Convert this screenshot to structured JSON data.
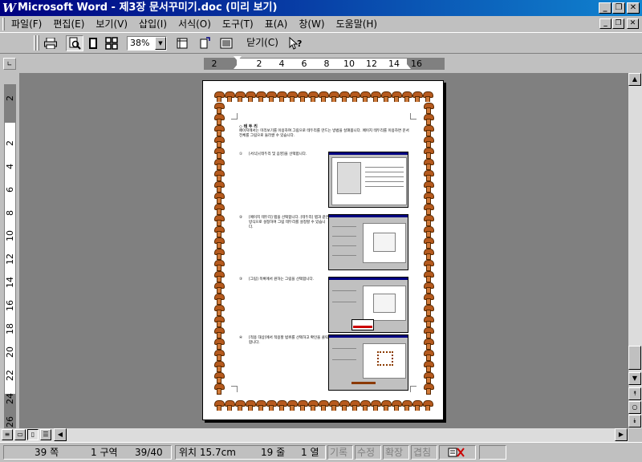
{
  "window": {
    "title": "Microsoft Word - 제3장 문서꾸미기.doc (미리 보기)",
    "app_icon": "W",
    "controls": {
      "minimize": "_",
      "restore": "❐",
      "close": "✕"
    }
  },
  "menu": {
    "items": [
      "파일(F)",
      "편집(E)",
      "보기(V)",
      "삽입(I)",
      "서식(O)",
      "도구(T)",
      "표(A)",
      "창(W)",
      "도움말(H)"
    ]
  },
  "toolbar": {
    "zoom_value": "38%",
    "close_label": "닫기(C)"
  },
  "ruler": {
    "horizontal_ticks": [
      "2",
      "2",
      "4",
      "6",
      "8",
      "10",
      "12",
      "14",
      "16"
    ],
    "vertical_ticks": [
      "2",
      "2",
      "4",
      "6",
      "8",
      "10",
      "12",
      "14",
      "16",
      "18",
      "20",
      "22",
      "24",
      "26"
    ]
  },
  "page": {
    "heading": "◇ 테 두 리",
    "intro": "페이지에서는 미리보기를 이용하여 그림으로 테두리를 만드는 방법을 살펴봅니다. 페이지 테두리를 이용하면 문서 전체를 그림으로 둘러쌀 수 있습니다.",
    "steps": [
      {
        "num": "①",
        "text": "[서식]-[테두리 및 음영]을 선택합니다."
      },
      {
        "num": "②",
        "text": "[페이지 테두리] 탭을 선택합니다. [테두리] 탭과 같은 방식으로 설정하며 그림 테두리를 설정할 수 있습니다."
      },
      {
        "num": "③",
        "text": "[그림] 목록에서 원하는 그림을 선택합니다."
      },
      {
        "num": "④",
        "text": "[적용 대상]에서 적용할 범위를 선택하고 확인을 클릭합니다."
      }
    ]
  },
  "status": {
    "page": "39 쪽",
    "section": "1 구역",
    "page_of": "39/40",
    "position": "위치 15.7cm",
    "line": "19 줄",
    "column": "1 열",
    "modes": [
      "기록",
      "수정",
      "확장",
      "겹침"
    ]
  }
}
